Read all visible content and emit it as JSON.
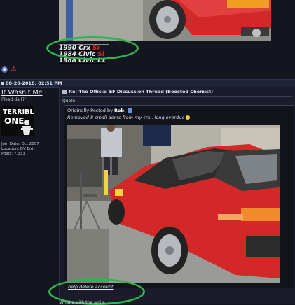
{
  "signature": {
    "lines": [
      {
        "name": "1990 Crx ",
        "suffix": "Si"
      },
      {
        "name": "1984 Civic ",
        "suffix": "Si"
      },
      {
        "name": "1988 Civic Lx",
        "suffix": ""
      }
    ]
  },
  "post": {
    "date": "08-20-2018, 02:51 PM",
    "title": "Re: The Official EF Discussion Thread (Boosted Chemist)",
    "quote_label": "Quote:",
    "quote_prefix": "Originally Posted by ",
    "quote_author": "Rob.",
    "quote_text": "Removed 8 small dents from my crx.. long overdue",
    "delete_link": "help delete account",
    "bottom_text": "What's with the smile"
  },
  "user": {
    "name": "It Wasn't Me",
    "title": "Plead da Fif",
    "avatar_text": [
      "TERRIBLE",
      "ONE"
    ],
    "join_date": "Join Date: Oct 2007",
    "location": "Location: DV Ent.",
    "posts": "Posts: 7,333"
  },
  "colors": {
    "highlight": "#2fb54d",
    "car_red": "#d42828",
    "si_red": "#e02020"
  },
  "icons": [
    "globe-icon",
    "warning-icon",
    "post-icon",
    "viewpost-icon",
    "smiley-icon"
  ]
}
